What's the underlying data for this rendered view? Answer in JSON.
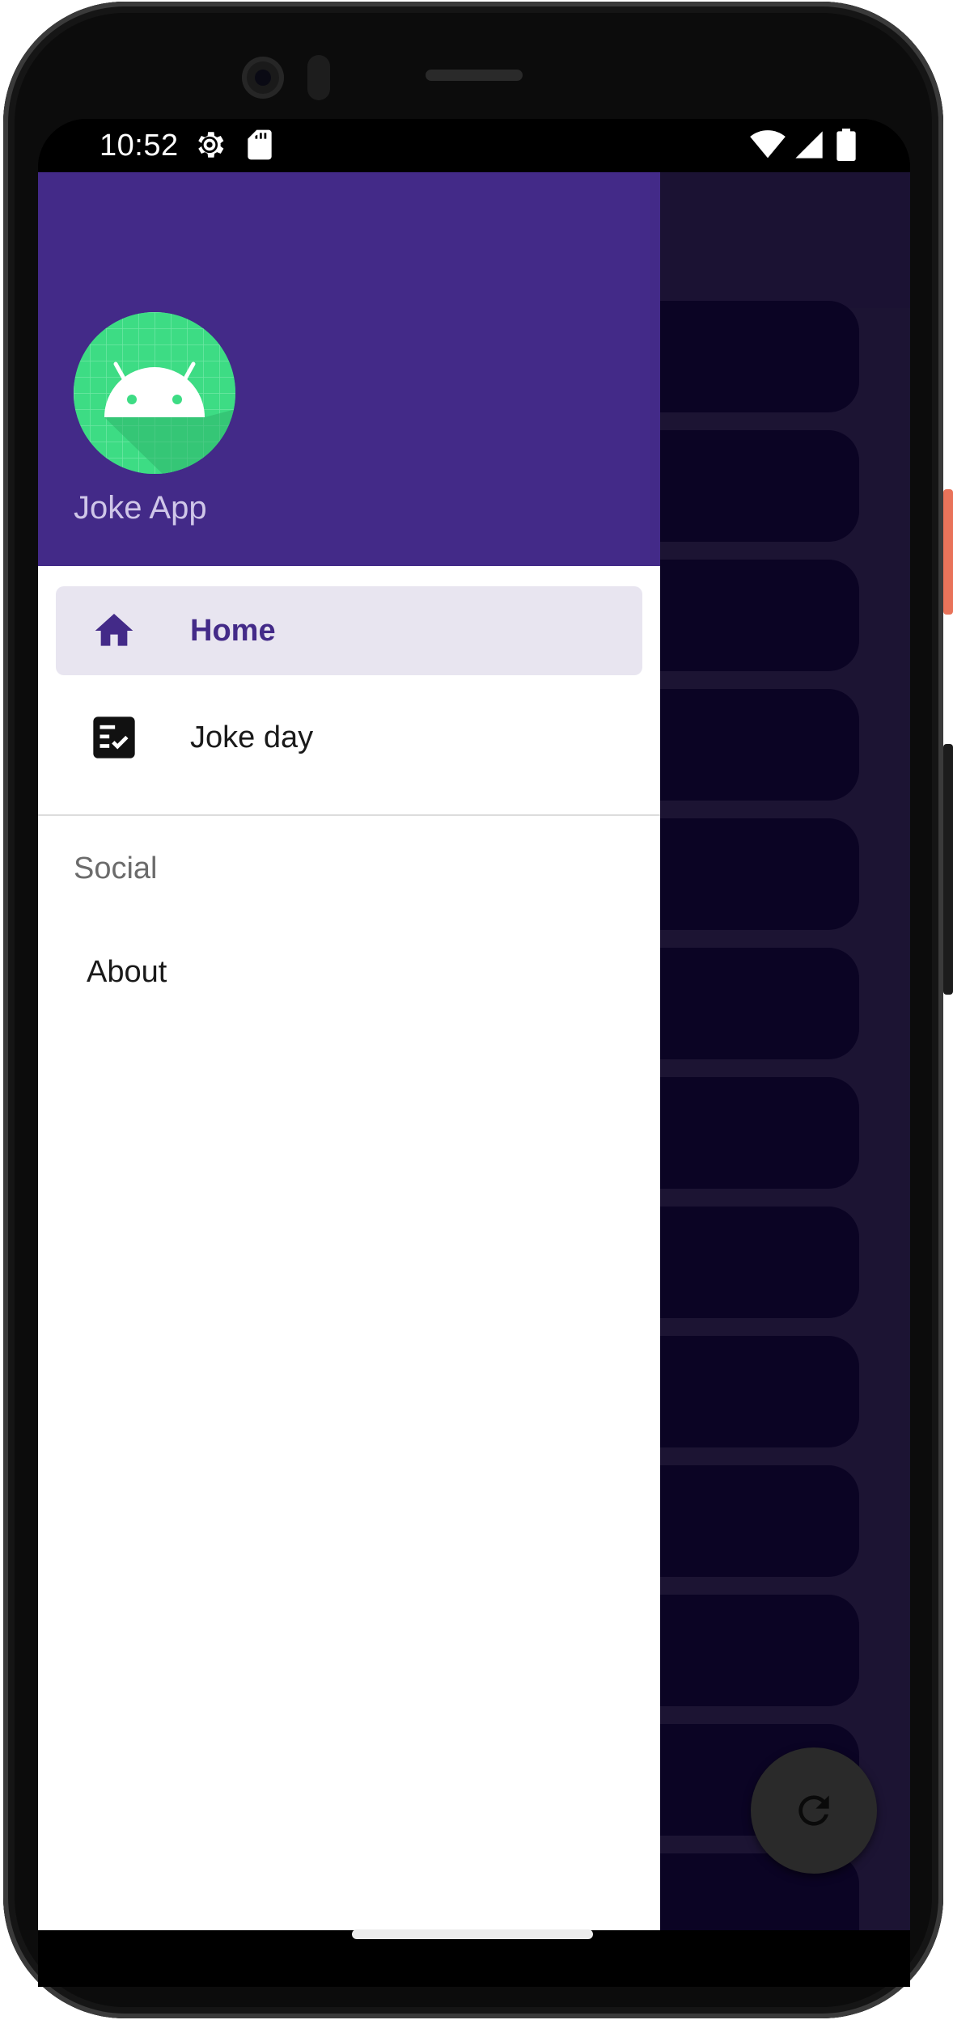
{
  "status_bar": {
    "time": "10:52",
    "left_icons": [
      "settings-icon",
      "sd-card-icon"
    ],
    "right_icons": [
      "wifi-icon",
      "signal-icon",
      "battery-icon"
    ]
  },
  "drawer": {
    "header": {
      "app_name": "Joke App",
      "header_color": "#432a88",
      "avatar_icon": "android-icon"
    },
    "items": [
      {
        "label": "Home",
        "icon": "home-icon",
        "active": true
      },
      {
        "label": "Joke day",
        "icon": "checklist-icon",
        "active": false
      }
    ],
    "section": {
      "title": "Social",
      "items": [
        {
          "label": "About"
        }
      ]
    }
  },
  "fab": {
    "icon": "refresh-icon"
  },
  "colors": {
    "primary": "#432a88",
    "active_item_bg": "#e8e5f0",
    "scrim_bg": "#1c1433",
    "card_bg": "#0b0424"
  }
}
